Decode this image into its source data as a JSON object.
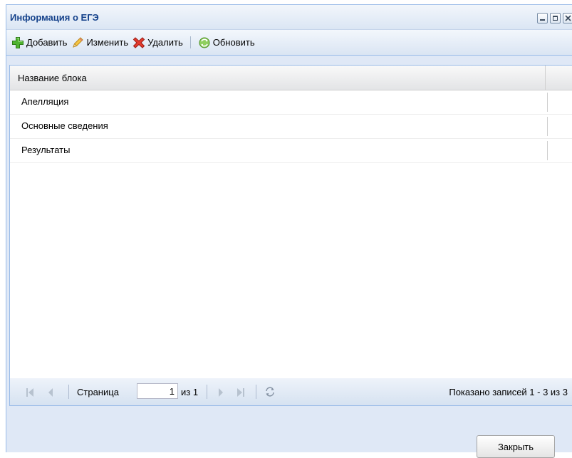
{
  "window": {
    "title": "Информация о ЕГЭ"
  },
  "toolbar": {
    "add_label": "Добавить",
    "edit_label": "Изменить",
    "delete_label": "Удалить",
    "refresh_label": "Обновить"
  },
  "grid": {
    "column_header": "Название блока",
    "rows": [
      "Апелляция",
      "Основные сведения",
      "Результаты"
    ]
  },
  "pager": {
    "page_label": "Страница",
    "page_value": "1",
    "of_label": "из 1",
    "status": "Показано записей 1 - 3 из 3"
  },
  "footer": {
    "close_label": "Закрыть"
  },
  "colors": {
    "title_text": "#15428b",
    "panel_bg": "#dfe8f6",
    "border": "#99bbe8"
  },
  "icons": {
    "add": "green-plus-icon",
    "edit": "pencil-icon",
    "delete": "red-x-icon",
    "refresh": "green-refresh-icon"
  }
}
